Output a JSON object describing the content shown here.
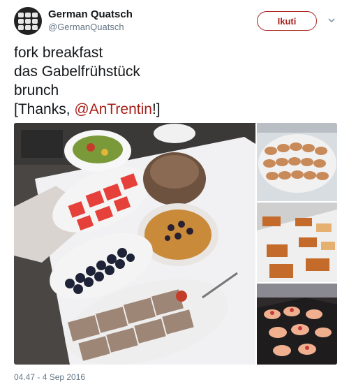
{
  "author": {
    "name": "German Quatsch",
    "handle": "@GermanQuatsch",
    "follow_label": "Ikuti"
  },
  "tweet": {
    "line1": "fork breakfast",
    "line2": "das Gabelfrühstück",
    "line3": "brunch",
    "line4_prefix": "[Thanks, ",
    "mention": "@AnTrentin",
    "line4_suffix": "!]"
  },
  "timestamp": "04.47 - 4 Sep 2016"
}
